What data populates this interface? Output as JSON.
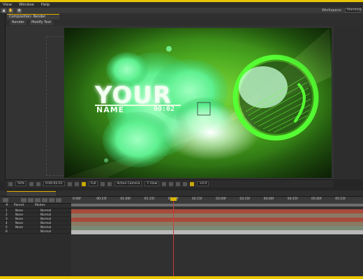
{
  "menu": [
    "View",
    "Window",
    "Help"
  ],
  "workspace_label": "Workspace:",
  "workspace_value": "Standard",
  "comp_panel": {
    "tab_label": "Composition: Render",
    "subtabs": [
      "Render",
      "Modify Text"
    ]
  },
  "preview": {
    "text_line1": "YOUR",
    "text_line2": "NAME",
    "timecode_text": "00:02"
  },
  "viewer_controls": {
    "zoom": "50%",
    "timecode": "0:00:02:01",
    "resolution": "Full",
    "camera": "Active Camera",
    "views": "1 View",
    "exposure": "+0.0"
  },
  "timeline": {
    "ruler": [
      "0:00f",
      "00:15f",
      "01:00f",
      "01:15f",
      "02:00f",
      "02:15f",
      "03:00f",
      "03:15f",
      "04:00f",
      "04:15f",
      "05:00f",
      "05:15f"
    ],
    "columns": [
      "#",
      "Parent",
      "Modes"
    ],
    "layers": [
      {
        "num": "1",
        "parent": "None",
        "mode": "Normal"
      },
      {
        "num": "2",
        "parent": "None",
        "mode": "Normal"
      },
      {
        "num": "3",
        "parent": "None",
        "mode": "Normal"
      },
      {
        "num": "4",
        "parent": "None",
        "mode": "Normal"
      },
      {
        "num": "5",
        "parent": "None",
        "mode": "Normal"
      },
      {
        "num": "6",
        "parent": "",
        "mode": "Normal"
      }
    ]
  },
  "colors": {
    "accent": "#e8c400",
    "track_red": "#a84a3c",
    "track_tan": "#8a7a64",
    "track_green": "#7a8a74",
    "track_grey": "#b8b8b8",
    "text_glow": "#e8ffe0",
    "ring_green": "#55ff33"
  }
}
